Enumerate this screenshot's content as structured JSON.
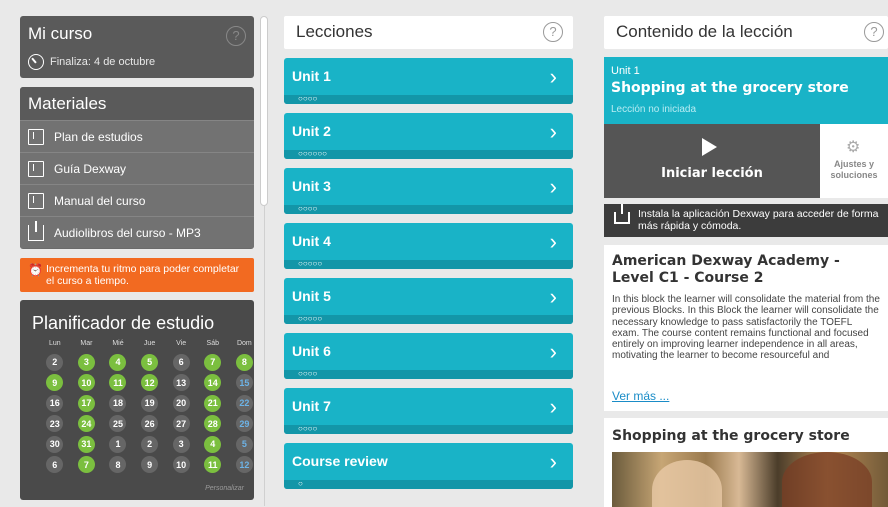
{
  "mi_curso": {
    "title": "Mi curso",
    "finish": "Finaliza: 4 de octubre",
    "help": "?"
  },
  "materiales": {
    "title": "Materiales",
    "items": [
      {
        "label": "Plan de estudios",
        "icon": "book-icon"
      },
      {
        "label": "Guía Dexway",
        "icon": "book-icon"
      },
      {
        "label": "Manual del curso",
        "icon": "book-icon"
      },
      {
        "label": "Audiolibros del curso - MP3",
        "icon": "download-icon"
      }
    ]
  },
  "ritmo_alert": {
    "text": "Incrementa tu ritmo para poder completar el curso a tiempo.",
    "color": "#f26a21"
  },
  "planificador": {
    "title": "Planificador de estudio",
    "weekdays": [
      "Lun",
      "Mar",
      "Mié",
      "Jue",
      "Vie",
      "Sáb",
      "Dom"
    ],
    "weeks": [
      [
        "2",
        "3",
        "4",
        "5",
        "6",
        "7",
        "8"
      ],
      [
        "9",
        "10",
        "11",
        "12",
        "13",
        "14",
        "15"
      ],
      [
        "16",
        "17",
        "18",
        "19",
        "20",
        "21",
        "22"
      ],
      [
        "23",
        "24",
        "25",
        "26",
        "27",
        "28",
        "29"
      ],
      [
        "30",
        "31",
        "1",
        "2",
        "3",
        "4",
        "5"
      ],
      [
        "6",
        "7",
        "8",
        "9",
        "10",
        "11",
        "12"
      ]
    ],
    "completed": [
      [
        false,
        true,
        true,
        true,
        false,
        true,
        true
      ],
      [
        true,
        true,
        true,
        true,
        false,
        true,
        false
      ],
      [
        false,
        true,
        false,
        false,
        false,
        true,
        false
      ],
      [
        false,
        true,
        false,
        false,
        false,
        true,
        false
      ],
      [
        false,
        true,
        false,
        false,
        false,
        true,
        false
      ],
      [
        false,
        true,
        false,
        false,
        false,
        true,
        false
      ]
    ],
    "personalizar": "Personalizar"
  },
  "lecciones": {
    "title": "Lecciones",
    "help": "?",
    "units": [
      {
        "label": "Unit 1",
        "dots": "○○○○"
      },
      {
        "label": "Unit 2",
        "dots": "○○○○○○"
      },
      {
        "label": "Unit 3",
        "dots": "○○○○"
      },
      {
        "label": "Unit 4",
        "dots": "○○○○○"
      },
      {
        "label": "Unit 5",
        "dots": "○○○○○"
      },
      {
        "label": "Unit 6",
        "dots": "○○○○"
      },
      {
        "label": "Unit 7",
        "dots": "○○○○"
      },
      {
        "label": "Course review",
        "dots": "○"
      }
    ],
    "chevron": "›"
  },
  "contenido": {
    "title": "Contenido de la lección",
    "help": "?",
    "unit_name": "Unit 1",
    "unit_title": "Shopping at the grocery store",
    "status": "Lección no iniciada",
    "start_label": "Iniciar lección",
    "settings_label": "Ajustes y soluciones",
    "app_banner": "Instala la aplicación Dexway para acceder de forma más rápida y cómoda.",
    "course_title": "American Dexway Academy - Level C1 - Course 2",
    "course_desc": "In this block the learner will consolidate the material from the previous Blocks. In this Block the learner will consolidate the necessary knowledge to pass satisfactorily the TOEFL exam. The course content remains functional and focused entirely on improving learner independence in all areas, motivating the learner to become resourceful and",
    "ver_mas": "Ver más ...",
    "shop_title": "Shopping at the grocery store"
  },
  "colors": {
    "accent": "#19b3c7",
    "accent_dark": "#1396a8",
    "completed_day": "#7bbf3f",
    "dark_panel": "#5a5a5a"
  }
}
